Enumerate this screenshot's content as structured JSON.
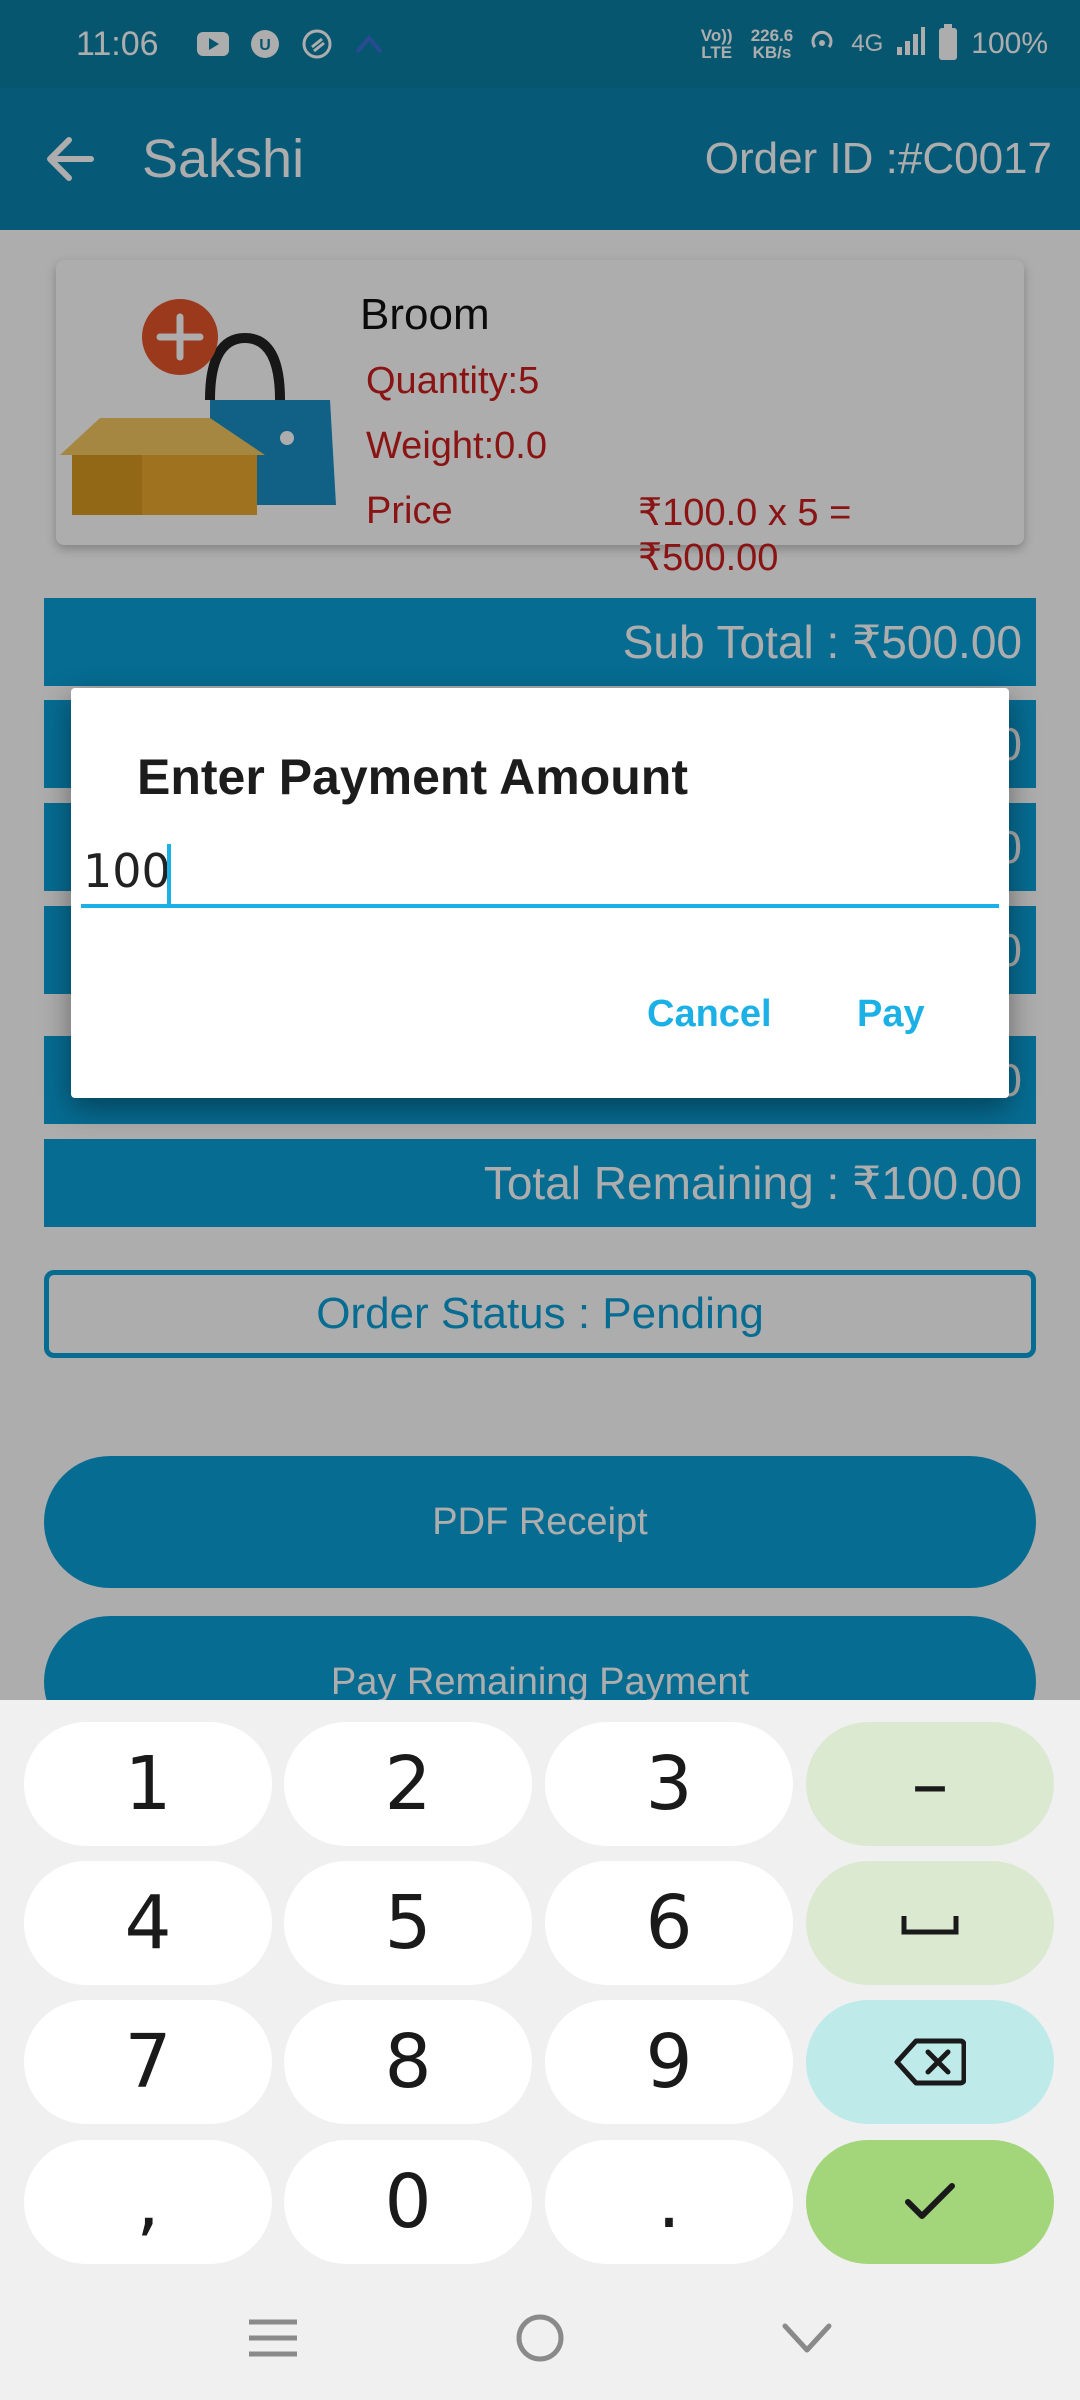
{
  "status_bar": {
    "time": "11:06",
    "net_speed": "226.6",
    "net_unit": "KB/s",
    "volte": "Vo)) LTE",
    "network": "4G",
    "battery": "100%"
  },
  "app_bar": {
    "title": "Sakshi",
    "order_id": "Order ID :#C0017"
  },
  "product": {
    "name": "Broom",
    "quantity": "Quantity:5",
    "weight": "Weight:0.0",
    "price_label": "Price",
    "price_calc": "₹100.0 x 5 = ₹500.00"
  },
  "summary": {
    "sub_total": "Sub Total : ₹500.00",
    "row2_tail": "0",
    "row3_tail": "0",
    "row4_tail": "0",
    "row5_tail": "0",
    "total_remaining": "Total Remaining : ₹100.00"
  },
  "order_status": "Order Status : Pending",
  "buttons": {
    "pdf_receipt": "PDF Receipt",
    "pay_remaining": "Pay Remaining Payment"
  },
  "dialog": {
    "title": "Enter Payment Amount",
    "amount_value": "100",
    "cancel": "Cancel",
    "pay": "Pay"
  },
  "keyboard": {
    "keys": [
      "1",
      "2",
      "3",
      "–",
      "4",
      "5",
      "6",
      "␣",
      "7",
      "8",
      "9",
      "⌫",
      ",",
      "0",
      ".",
      "✓"
    ]
  },
  "colors": {
    "primary": "#0a9fd8",
    "app_bar": "#0a84b0",
    "accent": "#1bb1e6",
    "price_red": "#cc1d1d"
  }
}
